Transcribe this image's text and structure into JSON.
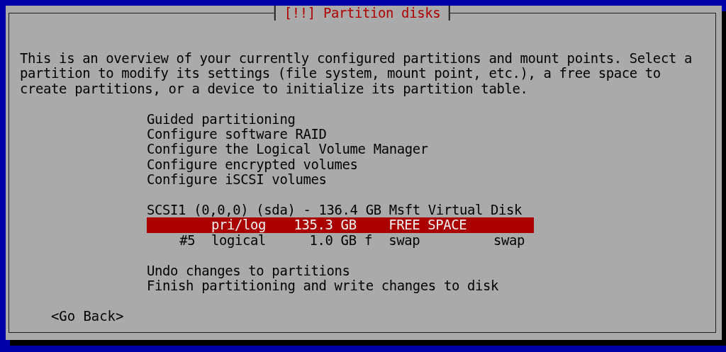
{
  "dialog": {
    "title": "[!!] Partition disks",
    "description": "This is an overview of your currently configured partitions and mount points. Select a partition to modify its settings (file system, mount point, etc.), a free space to create partitions, or a device to initialize its partition table.",
    "menu": [
      {
        "label": "Guided partitioning"
      },
      {
        "label": "Configure software RAID"
      },
      {
        "label": "Configure the Logical Volume Manager"
      },
      {
        "label": "Configure encrypted volumes"
      },
      {
        "label": "Configure iSCSI volumes"
      }
    ],
    "disk": {
      "label": "SCSI1 (0,0,0) (sda) - 136.4 GB Msft Virtual Disk",
      "partitions": [
        {
          "type": "pri/log",
          "size": "135.3 GB",
          "filesystem": "FREE SPACE",
          "selected": true
        },
        {
          "number": "#5",
          "type": "logical",
          "size": "1.0 GB",
          "flag": "f",
          "filesystem": "swap",
          "mount": "swap",
          "selected": false
        }
      ]
    },
    "actions": [
      {
        "label": "Undo changes to partitions"
      },
      {
        "label": "Finish partitioning and write changes to disk"
      }
    ],
    "buttons": [
      {
        "label": "<Go Back>"
      }
    ]
  }
}
